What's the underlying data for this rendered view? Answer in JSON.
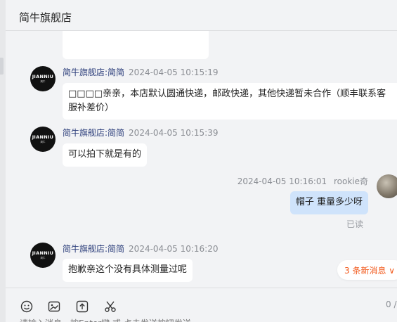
{
  "header": {
    "title": "简牛旗舰店"
  },
  "avatar_logo": {
    "text": "JIANNIU",
    "sub": "简牛"
  },
  "messages": [
    {
      "sender": "简牛旗舰店:简简",
      "time": "2024-04-05 10:15:19",
      "text": "□□□□亲亲，本店默认圆通快递，邮政快递，其他快递暂未合作（顺丰联系客服补差价）"
    },
    {
      "sender": "简牛旗舰店:简简",
      "time": "2024-04-05 10:15:39",
      "text": "可以拍下就是有的"
    },
    {
      "sender": "简牛旗舰店:简简",
      "time": "2024-04-05 10:16:20",
      "text": "抱歉亲这个没有具体测量过呢"
    }
  ],
  "user_message": {
    "time": "2024-04-05 10:16:01",
    "user": "rookie奇",
    "text": "帽子 重量多少呀",
    "status": "已读"
  },
  "new_messages": {
    "label": "3 条新消息 ∨"
  },
  "composer": {
    "counter": "0 /",
    "placeholder": "请输入消息，按Enter键 或 点击发送按钮发送"
  },
  "icons": [
    "emoji-icon",
    "image-icon",
    "upload-icon",
    "scissors-icon"
  ]
}
